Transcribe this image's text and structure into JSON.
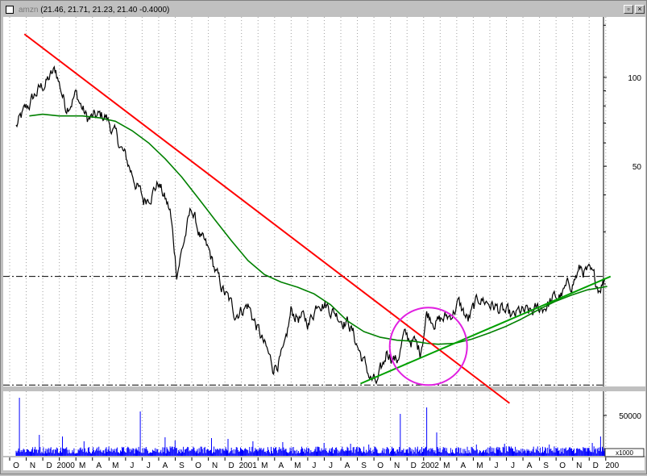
{
  "window": {
    "title": "(21.46, 21.71, 21.23, 21.40 -0.4000)",
    "ticker_label": "amzn"
  },
  "chart_data": [
    {
      "type": "line",
      "panel": "price",
      "y_scale": "log",
      "ylim": [
        9,
        160
      ],
      "y_tick_labels": [
        "100",
        "50"
      ],
      "y_tick_values": [
        100,
        50
      ],
      "x_tick_labels": [
        "O",
        "N",
        "D",
        "2000",
        "M",
        "A",
        "M",
        "J",
        "J",
        "A",
        "S",
        "O",
        "N",
        "D",
        "2001",
        "M",
        "A",
        "M",
        "J",
        "J",
        "A",
        "S",
        "O",
        "N",
        "D",
        "2002",
        "M",
        "A",
        "M",
        "J",
        "J",
        "A",
        "S",
        "O",
        "N",
        "D",
        "200"
      ],
      "grid": "vertical dotted",
      "price_anchors_month_index_value": [
        [
          0,
          68
        ],
        [
          1.2,
          88
        ],
        [
          2.4,
          105
        ],
        [
          3.0,
          80
        ],
        [
          3.6,
          88
        ],
        [
          4.3,
          72
        ],
        [
          5.4,
          74
        ],
        [
          6.2,
          60
        ],
        [
          7.1,
          46
        ],
        [
          7.7,
          38
        ],
        [
          8.6,
          44
        ],
        [
          9.3,
          35
        ],
        [
          9.7,
          22
        ],
        [
          10.6,
          36
        ],
        [
          11.2,
          28
        ],
        [
          11.7,
          25
        ],
        [
          12.3,
          20
        ],
        [
          13.2,
          16
        ],
        [
          14.0,
          17
        ],
        [
          14.6,
          14
        ],
        [
          15.5,
          10.5
        ],
        [
          16.2,
          11.6
        ],
        [
          16.6,
          16
        ],
        [
          17.3,
          15.2
        ],
        [
          17.7,
          14.8
        ],
        [
          18.3,
          18
        ],
        [
          19.0,
          16.5
        ],
        [
          19.6,
          15.5
        ],
        [
          20.1,
          14.8
        ],
        [
          20.9,
          11.2
        ],
        [
          21.4,
          9.6
        ],
        [
          21.8,
          9.1
        ],
        [
          22.2,
          10.6
        ],
        [
          22.4,
          12
        ],
        [
          23.0,
          11
        ],
        [
          23.4,
          13.2
        ],
        [
          24.0,
          12.8
        ],
        [
          24.4,
          11.8
        ],
        [
          24.8,
          16
        ],
        [
          25.5,
          14.9
        ],
        [
          26.2,
          15.6
        ],
        [
          26.7,
          17.2
        ],
        [
          27.3,
          15
        ],
        [
          28.0,
          18
        ],
        [
          28.6,
          17.2
        ],
        [
          29.3,
          16.2
        ],
        [
          30.0,
          15.2
        ],
        [
          30.4,
          16
        ],
        [
          31.0,
          15.8
        ],
        [
          31.6,
          16.4
        ],
        [
          32.4,
          17.6
        ],
        [
          33.0,
          18.4
        ],
        [
          33.5,
          20
        ],
        [
          34.1,
          22.5
        ],
        [
          34.6,
          21.5
        ],
        [
          35.2,
          19.6
        ],
        [
          35.6,
          21.4
        ]
      ],
      "moving_average_anchors": [
        [
          0.8,
          74
        ],
        [
          1.6,
          75
        ],
        [
          2.6,
          74
        ],
        [
          4.0,
          74
        ],
        [
          5.0,
          73
        ],
        [
          6.0,
          71
        ],
        [
          7.0,
          66
        ],
        [
          8.0,
          60
        ],
        [
          9.0,
          53
        ],
        [
          10.0,
          46
        ],
        [
          11.0,
          39
        ],
        [
          12.0,
          33
        ],
        [
          13.0,
          28
        ],
        [
          14.0,
          24
        ],
        [
          15.0,
          21.5
        ],
        [
          16.0,
          20.3
        ],
        [
          17.0,
          19.5
        ],
        [
          18.0,
          18.5
        ],
        [
          19.0,
          17
        ],
        [
          20.0,
          15
        ],
        [
          21.0,
          13.8
        ],
        [
          22.0,
          13.2
        ],
        [
          23.0,
          12.9
        ],
        [
          24.0,
          12.8
        ],
        [
          24.8,
          12.6
        ],
        [
          25.5,
          12.5
        ],
        [
          26.5,
          12.6
        ],
        [
          27.5,
          13.0
        ],
        [
          28.5,
          13.6
        ],
        [
          29.5,
          14.3
        ],
        [
          30.5,
          15.2
        ],
        [
          31.5,
          16.3
        ],
        [
          32.5,
          17.4
        ],
        [
          33.5,
          18.3
        ],
        [
          34.5,
          19.1
        ],
        [
          35.7,
          19.6
        ]
      ],
      "downtrend_line": [
        [
          0.5,
          140
        ],
        [
          29.8,
          7.9
        ]
      ],
      "uptrend_line": [
        [
          20.8,
          9.2
        ],
        [
          35.9,
          21.2
        ]
      ],
      "horizontal_levels": [
        21.2,
        9.1
      ],
      "highlight_circle_center": [
        24.9,
        12.3
      ],
      "colors": {
        "price": "#000000",
        "moving_average": "#008000",
        "downtrend": "#ff0000",
        "uptrend": "#00a000",
        "circle": "#e020e0",
        "level": "#000000",
        "grid": "#a0a0a0"
      }
    },
    {
      "type": "bar",
      "panel": "volume",
      "y_tick_labels": [
        "50000"
      ],
      "y_tick_values": [
        50000
      ],
      "unit_label": "x1000",
      "ylim": [
        0,
        80000
      ],
      "volume_spikes_month_index_value": [
        [
          0.2,
          72000
        ],
        [
          1.4,
          26000
        ],
        [
          2.8,
          24000
        ],
        [
          4.1,
          18000
        ],
        [
          7.5,
          55000
        ],
        [
          9.0,
          23000
        ],
        [
          9.6,
          19000
        ],
        [
          11.8,
          22000
        ],
        [
          12.8,
          21000
        ],
        [
          14.3,
          18000
        ],
        [
          16.1,
          17000
        ],
        [
          18.6,
          16000
        ],
        [
          20.2,
          15000
        ],
        [
          21.3,
          14000
        ],
        [
          23.2,
          52000
        ],
        [
          24.8,
          60000
        ],
        [
          25.4,
          29000
        ],
        [
          27.8,
          14000
        ],
        [
          29.5,
          15000
        ],
        [
          32.2,
          14000
        ],
        [
          34.8,
          16000
        ],
        [
          35.3,
          24000
        ]
      ],
      "base_volume": 9000,
      "colors": {
        "bars": "#0000ff",
        "grid": "#a0a0a0"
      }
    }
  ]
}
